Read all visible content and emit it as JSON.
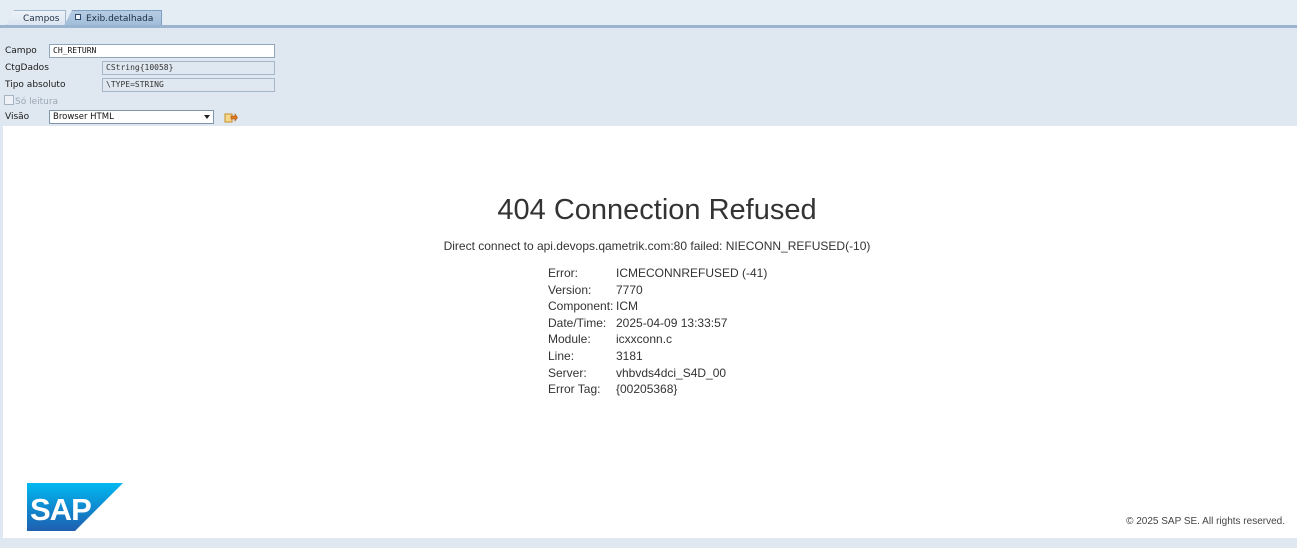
{
  "tabs": [
    {
      "label": "Campos",
      "active": false
    },
    {
      "label": "Exib.detalhada",
      "active": true
    }
  ],
  "form": {
    "campo": {
      "label": "Campo",
      "value": "CH_RETURN"
    },
    "ctgdados": {
      "label": "CtgDados",
      "value": "CString{10058}"
    },
    "tipo_absoluto": {
      "label": "Tipo absoluto",
      "value": "\\TYPE=STRING"
    },
    "so_leitura": {
      "label": "Só leitura",
      "checked": false,
      "enabled": false
    },
    "visao": {
      "label": "Visão",
      "selected": "Browser HTML"
    }
  },
  "page": {
    "title": "404 Connection Refused",
    "subtitle": "Direct connect to api.devops.qametrik.com:80 failed: NIECONN_REFUSED(-10)",
    "details": [
      {
        "key": "Error:",
        "value": "ICMECONNREFUSED (-41)"
      },
      {
        "key": "Version:",
        "value": "7770"
      },
      {
        "key": "Component:",
        "value": "ICM"
      },
      {
        "key": "Date/Time:",
        "value": "2025-04-09 13:33:57"
      },
      {
        "key": "Module:",
        "value": "icxxconn.c"
      },
      {
        "key": "Line:",
        "value": "3181"
      },
      {
        "key": "Server:",
        "value": "vhbvds4dci_S4D_00"
      },
      {
        "key": "Error Tag:",
        "value": "{00205368}"
      }
    ],
    "logo": {
      "text": "SAP",
      "color_top": "#00b8f1",
      "color_bottom": "#1e5fb0"
    },
    "copyright": "© 2025 SAP SE. All rights reserved."
  },
  "colors": {
    "frame_bg": "#dfe8f1",
    "tab_active": "#a9c3de",
    "tab_line": "#9ab4cf"
  },
  "icons": {
    "refresh": "refresh-icon",
    "dropdown": "chevron-down-icon",
    "tab_detail": "detail-view-icon"
  }
}
